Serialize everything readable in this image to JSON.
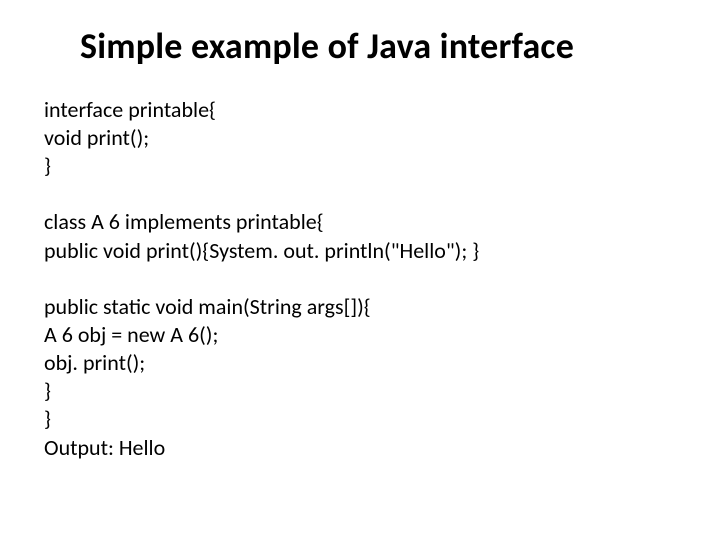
{
  "title": "Simple example of Java interface",
  "code": {
    "p1": {
      "l1": "interface printable{",
      "l2": "void print();",
      "l3": "}"
    },
    "p2": {
      "l1": "class A 6 implements printable{",
      "l2": "public void print(){System. out. println(\"Hello\"); }"
    },
    "p3": {
      "l1": "public static void main(String args[]){",
      "l2": "A 6 obj = new A 6();",
      "l3": "obj. print();",
      "l4": " }",
      "l5": "}",
      "l6": "Output: Hello"
    }
  }
}
